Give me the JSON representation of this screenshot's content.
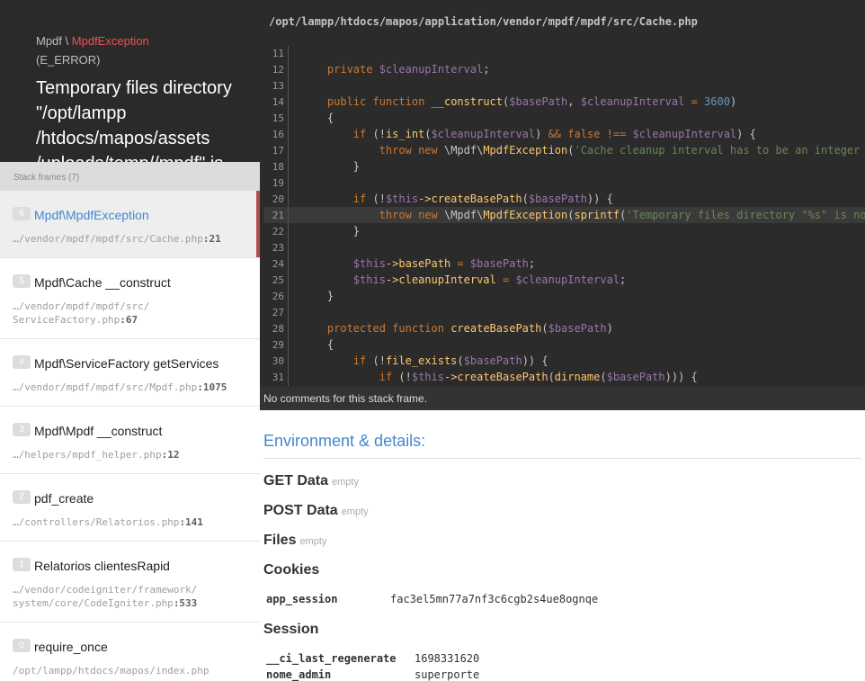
{
  "header": {
    "exception_ns": "Mpdf",
    "exception_sep": "\\",
    "exception_class": "MpdfException",
    "exception_type": "(E_ERROR)",
    "message": "Temporary files directory \"/opt/lampp /htdocs/mapos/assets /uploads/temp//mpdf\" is"
  },
  "frames_header": "Stack frames (7)",
  "frames": [
    {
      "index": "6",
      "title": "Mpdf\\MpdfException",
      "file": "…/vendor/mpdf/mpdf/src/Cache.php",
      "line": ":21",
      "active": true
    },
    {
      "index": "5",
      "title": "Mpdf\\Cache __construct",
      "file": "…/vendor/mpdf/mpdf/src/ ServiceFactory.php",
      "line": ":67"
    },
    {
      "index": "4",
      "title": "Mpdf\\ServiceFactory getServices",
      "file": "…/vendor/mpdf/mpdf/src/Mpdf.php",
      "line": ":1075"
    },
    {
      "index": "3",
      "title": "Mpdf\\Mpdf __construct",
      "file": "…/helpers/mpdf_helper.php",
      "line": ":12"
    },
    {
      "index": "2",
      "title": "pdf_create",
      "file": "…/controllers/Relatorios.php",
      "line": ":141"
    },
    {
      "index": "1",
      "title": "Relatorios clientesRapid",
      "file": "…/vendor/codeigniter/framework/ system/core/CodeIgniter.php",
      "line": ":533"
    },
    {
      "index": "0",
      "title": "require_once",
      "file": "/opt/lampp/htdocs/mapos/index.php",
      "line": ""
    }
  ],
  "code": {
    "file_path": "/opt/lampp/htdocs/mapos/application/vendor/mpdf/mpdf/src/Cache.php",
    "highlight_line": "21",
    "lines": [
      {
        "n": "11",
        "t": ""
      },
      {
        "n": "12",
        "t": "    private $cleanupInterval;"
      },
      {
        "n": "13",
        "t": ""
      },
      {
        "n": "14",
        "t": "    public function __construct($basePath, $cleanupInterval = 3600)"
      },
      {
        "n": "15",
        "t": "    {"
      },
      {
        "n": "16",
        "t": "        if (!is_int($cleanupInterval) && false !== $cleanupInterval) {"
      },
      {
        "n": "17",
        "t": "            throw new \\Mpdf\\MpdfException('Cache cleanup interval has to be an integer or false');"
      },
      {
        "n": "18",
        "t": "        }"
      },
      {
        "n": "19",
        "t": ""
      },
      {
        "n": "20",
        "t": "        if (!$this->createBasePath($basePath)) {"
      },
      {
        "n": "21",
        "t": "            throw new \\Mpdf\\MpdfException(sprintf('Temporary files directory \"%s\" is not writable', $basePath));"
      },
      {
        "n": "22",
        "t": "        }"
      },
      {
        "n": "23",
        "t": ""
      },
      {
        "n": "24",
        "t": "        $this->basePath = $basePath;"
      },
      {
        "n": "25",
        "t": "        $this->cleanupInterval = $cleanupInterval;"
      },
      {
        "n": "26",
        "t": "    }"
      },
      {
        "n": "27",
        "t": ""
      },
      {
        "n": "28",
        "t": "    protected function createBasePath($basePath)"
      },
      {
        "n": "29",
        "t": "    {"
      },
      {
        "n": "30",
        "t": "        if (!file_exists($basePath)) {"
      },
      {
        "n": "31",
        "t": "            if (!$this->createBasePath(dirname($basePath))) {"
      }
    ]
  },
  "comments": "No comments for this stack frame.",
  "env": {
    "title": "Environment & details:",
    "get_label": "GET Data",
    "get_empty": "empty",
    "post_label": "POST Data",
    "post_empty": "empty",
    "files_label": "Files",
    "files_empty": "empty",
    "cookies_label": "Cookies",
    "cookies": [
      {
        "k": "app_session",
        "v": "fac3el5mn77a7nf3c6cgb2s4ue8ognqe"
      }
    ],
    "session_label": "Session",
    "session": [
      {
        "k": "__ci_last_regenerate",
        "v": "1698331620"
      },
      {
        "k": "nome_admin",
        "v": "superporte"
      }
    ]
  },
  "colors": {
    "accent": "#4288ce",
    "error": "#e95353",
    "active_bar": "#ad4e4e",
    "code_bg": "#2b2b2b"
  }
}
